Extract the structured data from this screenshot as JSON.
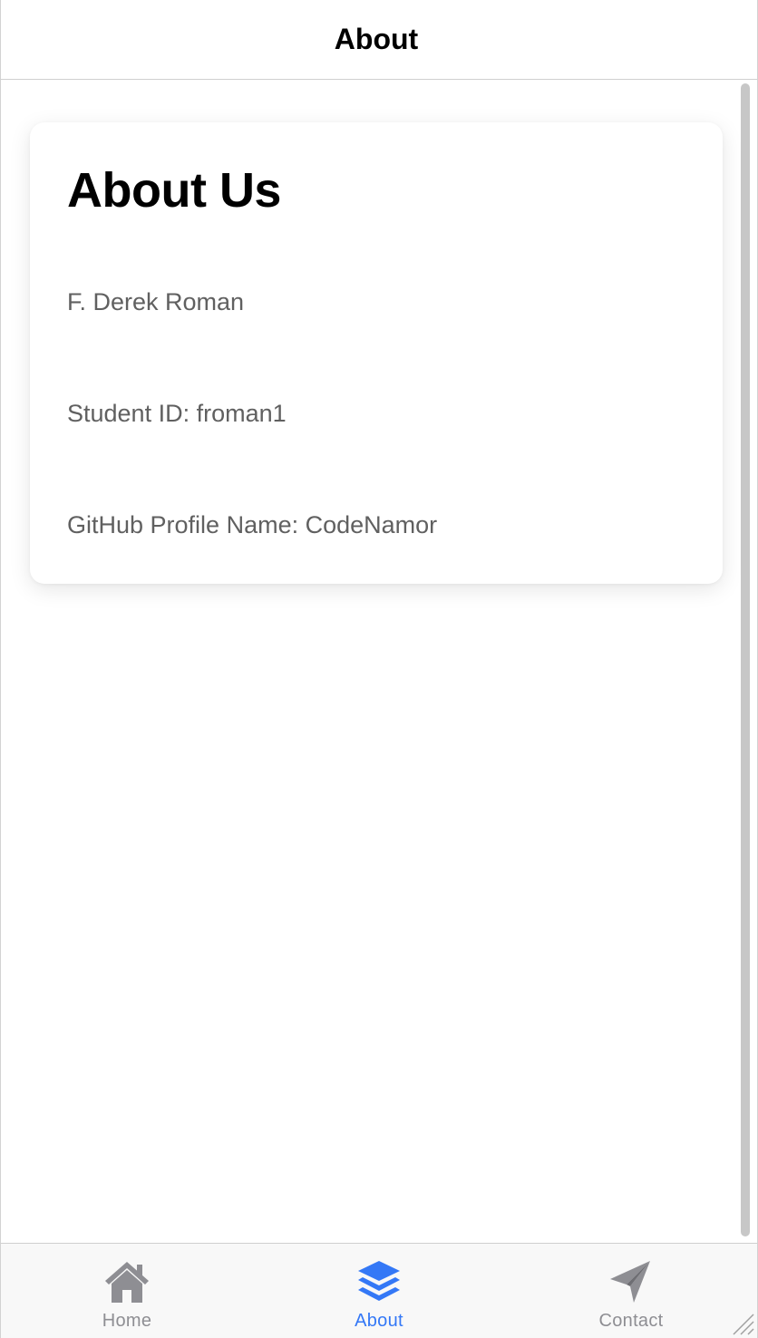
{
  "header": {
    "title": "About"
  },
  "card": {
    "title": "About Us",
    "lines": [
      "F. Derek Roman",
      "Student ID: froman1",
      "GitHub Profile Name: CodeNamor"
    ]
  },
  "tabs": [
    {
      "label": "Home",
      "icon": "home-icon",
      "active": false
    },
    {
      "label": "About",
      "icon": "layers-icon",
      "active": true
    },
    {
      "label": "Contact",
      "icon": "send-icon",
      "active": false
    }
  ],
  "colors": {
    "active_tab": "#3478f6",
    "inactive_tab": "#8e8e93",
    "card_text": "#606060"
  }
}
